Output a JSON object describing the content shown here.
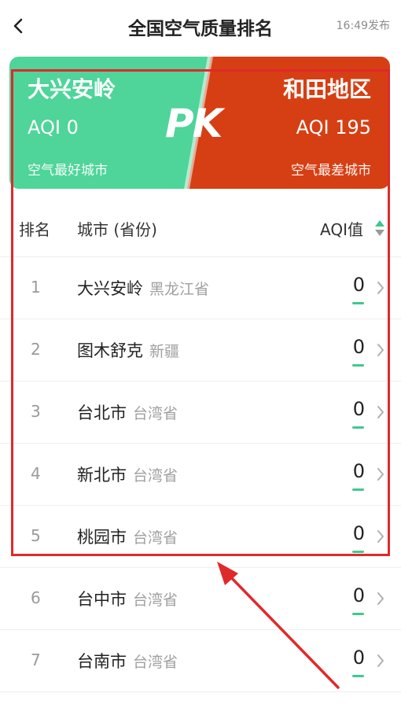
{
  "header": {
    "back_icon": "chevron-left-icon",
    "title": "全国空气质量排名",
    "publish_time": "16:49发布"
  },
  "pk": {
    "best": {
      "city": "大兴安岭",
      "aqi": "AQI 0",
      "label": "空气最好城市",
      "color": "#4fd49a"
    },
    "worst": {
      "city": "和田地区",
      "aqi": "AQI 195",
      "label": "空气最差城市",
      "color": "#d63f14"
    },
    "mark": "PK"
  },
  "table": {
    "col_rank": "排名",
    "col_city": "城市 (省份)",
    "col_aqi": "AQI值",
    "sort_icon": "sort-icon",
    "rows": [
      {
        "rank": "1",
        "city": "大兴安岭",
        "province": "黑龙江省",
        "aqi": "0"
      },
      {
        "rank": "2",
        "city": "图木舒克",
        "province": "新疆",
        "aqi": "0"
      },
      {
        "rank": "3",
        "city": "台北市",
        "province": "台湾省",
        "aqi": "0"
      },
      {
        "rank": "4",
        "city": "新北市",
        "province": "台湾省",
        "aqi": "0"
      },
      {
        "rank": "5",
        "city": "桃园市",
        "province": "台湾省",
        "aqi": "0"
      },
      {
        "rank": "6",
        "city": "台中市",
        "province": "台湾省",
        "aqi": "0"
      },
      {
        "rank": "7",
        "city": "台南市",
        "province": "台湾省",
        "aqi": "0"
      }
    ]
  },
  "colors": {
    "accent_green": "#3fc98e",
    "highlight_red": "#e0292b"
  }
}
